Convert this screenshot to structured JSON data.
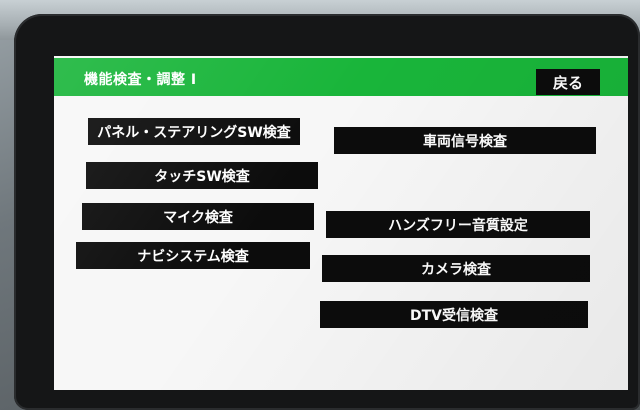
{
  "header": {
    "title": "機能検査・調整 I",
    "back_label": "戻る"
  },
  "menu": {
    "panel_steering": "パネル・ステアリングSW検査",
    "touch_sw": "タッチSW検査",
    "mic": "マイク検査",
    "navi_system": "ナビシステム検査",
    "vehicle_signal": "車両信号検査",
    "handsfree": "ハンズフリー音質設定",
    "camera": "カメラ検査",
    "dtv": "DTV受信検査"
  },
  "colors": {
    "title_bar": "#19b53a",
    "button_bg": "#0c0c0c",
    "button_text": "#ffffff",
    "screen_bg": "#f7f7f7"
  }
}
